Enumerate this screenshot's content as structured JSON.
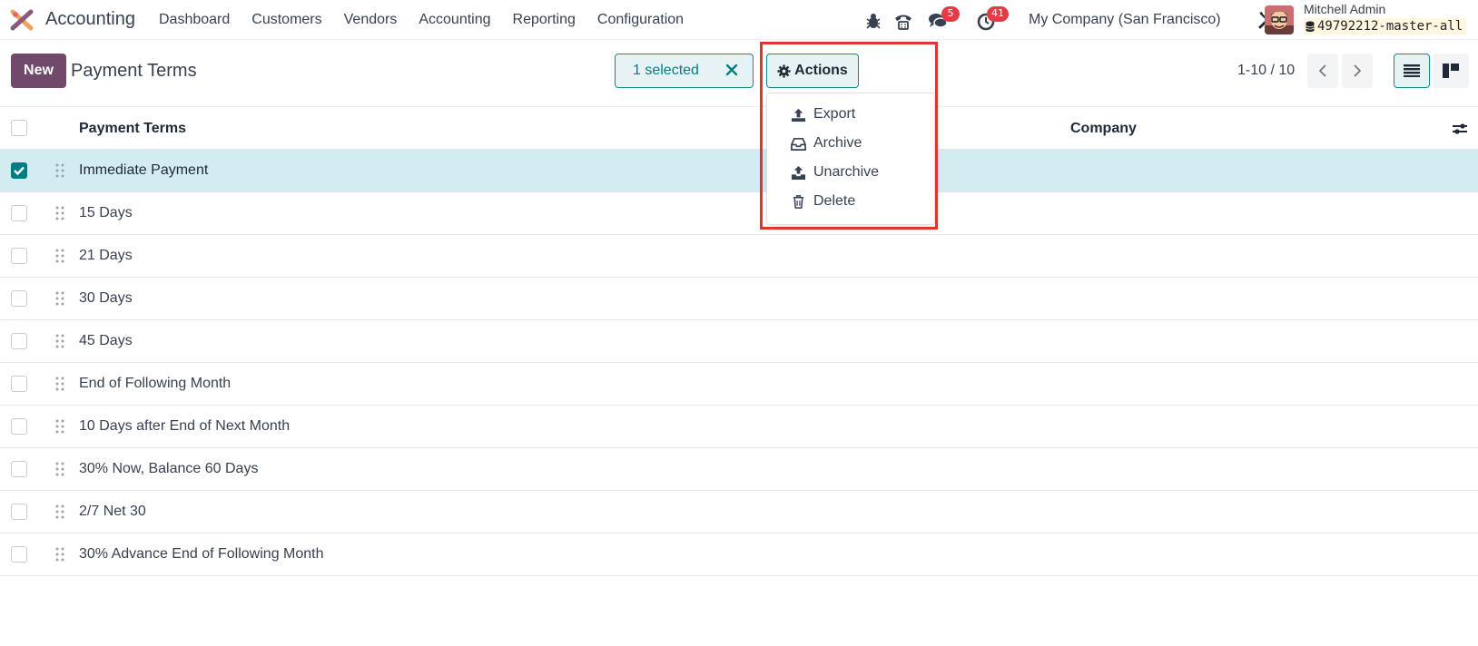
{
  "app": {
    "name": "Accounting"
  },
  "menu": [
    "Dashboard",
    "Customers",
    "Vendors",
    "Accounting",
    "Reporting",
    "Configuration"
  ],
  "systray": {
    "messages_count": "5",
    "activities_count": "41",
    "company": "My Company (San Francisco)",
    "user_name": "Mitchell Admin",
    "database": "49792212-master-all"
  },
  "control_panel": {
    "new_label": "New",
    "title": "Payment Terms",
    "selected_label": "1 selected",
    "actions_label": "Actions",
    "pager": "1-10 / 10"
  },
  "table": {
    "columns": [
      "Payment Terms",
      "Company"
    ],
    "rows": [
      {
        "name": "Immediate Payment",
        "checked": true
      },
      {
        "name": "15 Days",
        "checked": false
      },
      {
        "name": "21 Days",
        "checked": false
      },
      {
        "name": "30 Days",
        "checked": false
      },
      {
        "name": "45 Days",
        "checked": false
      },
      {
        "name": "End of Following Month",
        "checked": false
      },
      {
        "name": "10 Days after End of Next Month",
        "checked": false
      },
      {
        "name": "30% Now, Balance 60 Days",
        "checked": false
      },
      {
        "name": "2/7 Net 30",
        "checked": false
      },
      {
        "name": "30% Advance End of Following Month",
        "checked": false
      }
    ]
  },
  "actions_menu": {
    "items": [
      {
        "label": "Export",
        "icon": "upload-icon"
      },
      {
        "label": "Archive",
        "icon": "inbox-icon"
      },
      {
        "label": "Unarchive",
        "icon": "unarchive-icon"
      },
      {
        "label": "Delete",
        "icon": "trash-icon"
      }
    ]
  },
  "colors": {
    "brand": "#71496a",
    "accent": "#017e84",
    "selected_row": "#d3ecf1",
    "badge": "#e53b47",
    "highlight": "#e0342e"
  }
}
